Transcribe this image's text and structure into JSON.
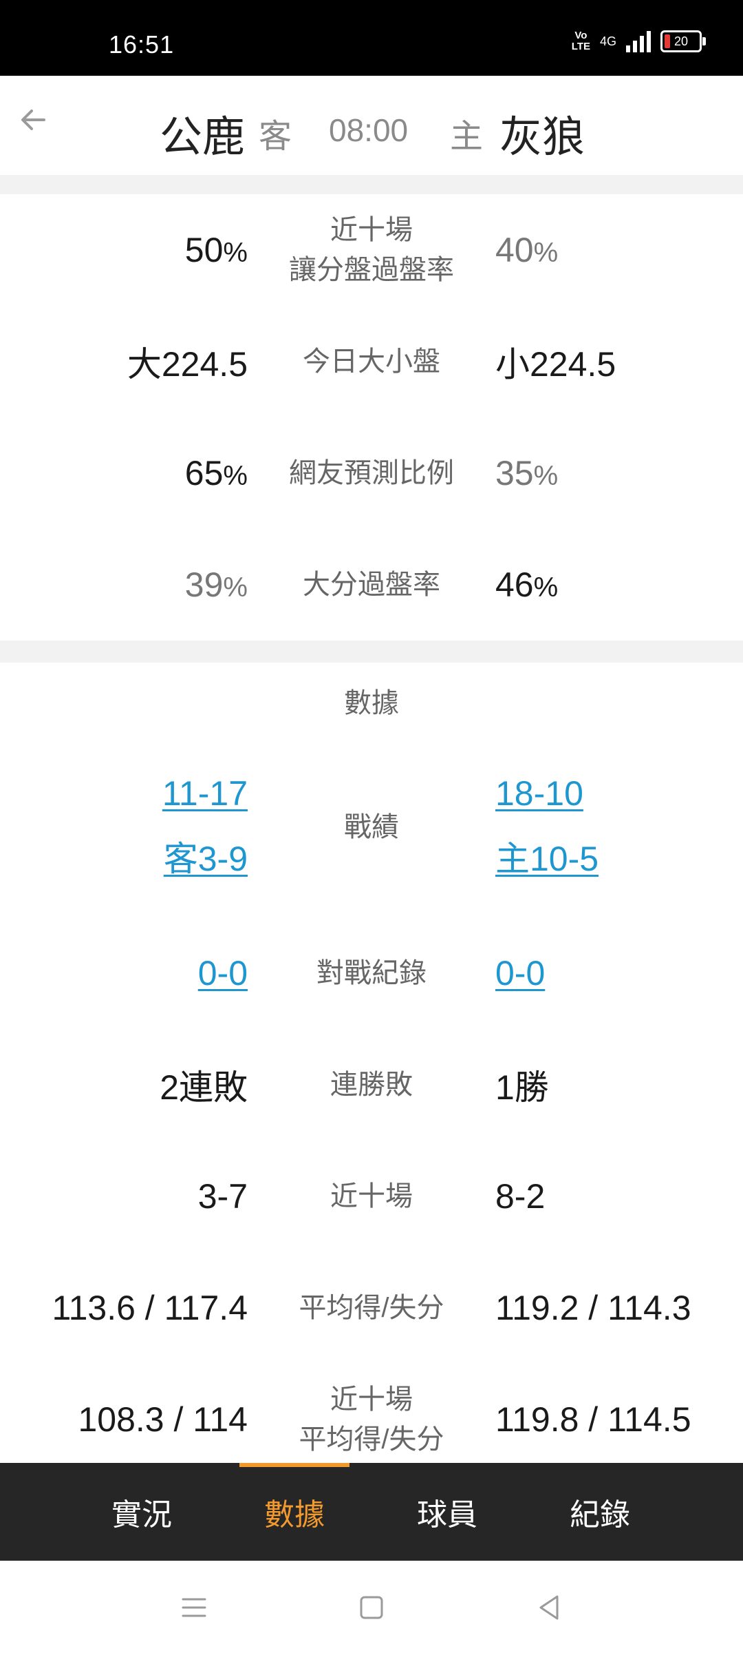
{
  "status": {
    "time": "16:51",
    "volte": "Vo\nLTE",
    "network": "4G",
    "battery": "20"
  },
  "header": {
    "away_team": "公鹿",
    "away_tag": "客",
    "time": "08:00",
    "home_tag": "主",
    "home_team": "灰狼"
  },
  "odds_rows": [
    {
      "label": "近十場\n讓分盤過盤率",
      "left": "50",
      "left_unit": "%",
      "right": "40",
      "right_unit": "%"
    },
    {
      "label": "今日大小盤",
      "left": "大224.5",
      "right": "小224.5"
    },
    {
      "label": "網友預測比例",
      "left": "65",
      "left_unit": "%",
      "right": "35",
      "right_unit": "%"
    },
    {
      "label": "大分過盤率",
      "left": "39",
      "left_unit": "%",
      "right": "46",
      "right_unit": "%"
    }
  ],
  "stats": {
    "section_title": "數據",
    "record": {
      "label": "戰績",
      "left_1": "11-17",
      "left_2": "客3-9",
      "right_1": "18-10",
      "right_2": "主10-5"
    },
    "h2h": {
      "label": "對戰紀錄",
      "left": "0-0",
      "right": "0-0"
    },
    "streak": {
      "label": "連勝敗",
      "left": "2連敗",
      "right": "1勝"
    },
    "last10": {
      "label": "近十場",
      "left": "3-7",
      "right": "8-2"
    },
    "avg": {
      "label": "平均得/失分",
      "left": "113.6 / 117.4",
      "right": "119.2 / 114.3"
    },
    "last10_avg": {
      "label": "近十場\n平均得/失分",
      "left": "108.3 / 114",
      "right": "119.8 / 114.5"
    }
  },
  "tabs": [
    {
      "label": "實況",
      "active": false
    },
    {
      "label": "數據",
      "active": true
    },
    {
      "label": "球員",
      "active": false
    },
    {
      "label": "紀錄",
      "active": false
    }
  ],
  "colors": {
    "accent": "#f39a2e",
    "link": "#1e96d0",
    "tabbar": "#262626"
  }
}
